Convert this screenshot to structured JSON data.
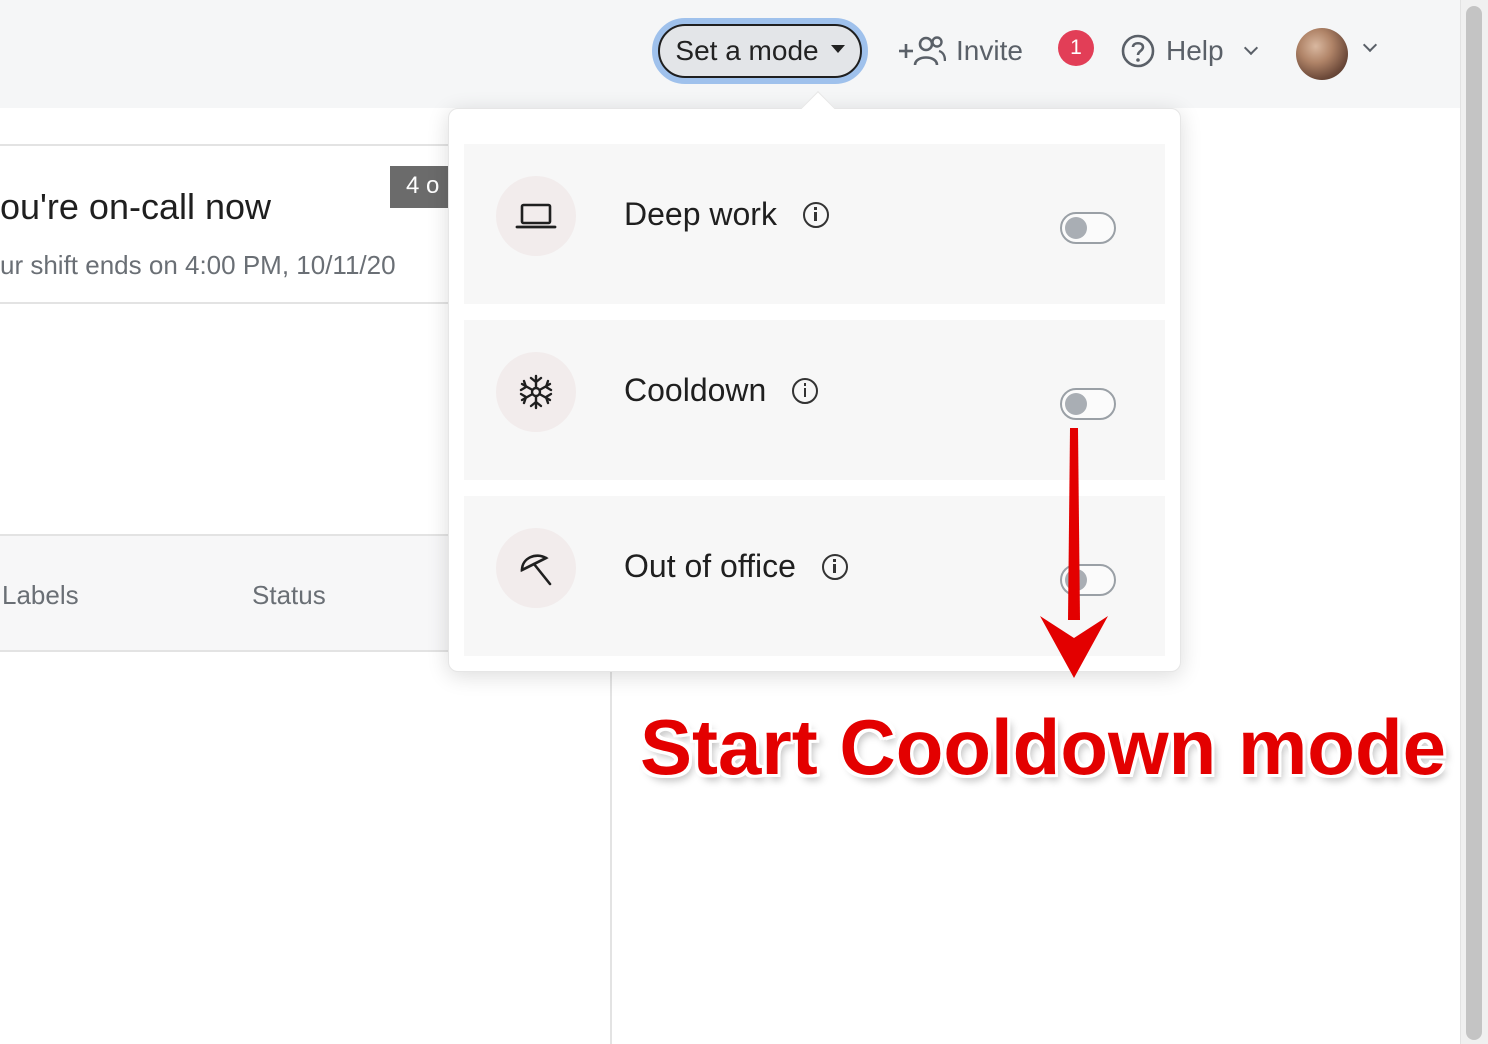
{
  "header": {
    "mode_button_label": "Set a mode",
    "invite_label": "Invite",
    "notification_count": "1",
    "help_label": "Help",
    "icons": {
      "invite": "add-person-icon",
      "help": "question-circle-icon",
      "avatar": "user-avatar"
    }
  },
  "oncall": {
    "title": "ou're on-call now",
    "subtitle": "ur shift ends on 4:00 PM, 10/11/20",
    "count_chip": "4 o"
  },
  "table": {
    "headers": [
      "Labels",
      "Status"
    ]
  },
  "modes": [
    {
      "label": "Deep work",
      "icon": "laptop-icon",
      "enabled": false
    },
    {
      "label": "Cooldown",
      "icon": "snowflake-icon",
      "enabled": false
    },
    {
      "label": "Out of office",
      "icon": "beach-umbrella-icon",
      "enabled": false
    }
  ],
  "annotation": {
    "text": "Start Cooldown mode",
    "color": "#e30000"
  },
  "colors": {
    "badge": "#e23e57",
    "focus_ring": "#9fc1ec",
    "toggle_off": "#a9aeb4"
  }
}
